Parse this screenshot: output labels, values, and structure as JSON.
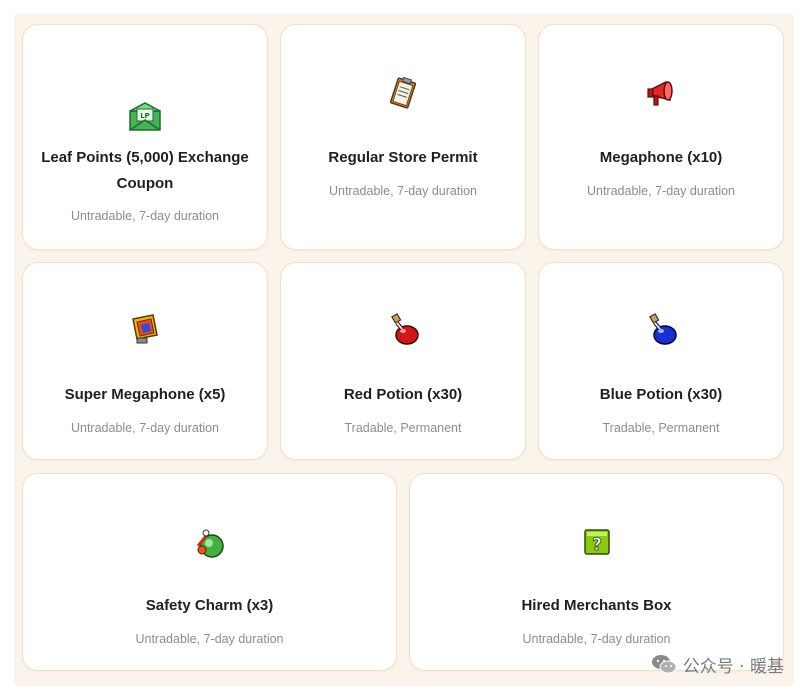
{
  "items": [
    {
      "title": "Leaf Points (5,000) Exchange Coupon",
      "subtitle": "Untradable, 7-day duration",
      "icon": "leaf-points-coupon-icon"
    },
    {
      "title": "Regular Store Permit",
      "subtitle": "Untradable, 7-day duration",
      "icon": "store-permit-icon"
    },
    {
      "title": "Megaphone (x10)",
      "subtitle": "Untradable, 7-day duration",
      "icon": "megaphone-icon"
    },
    {
      "title": "Super Megaphone (x5)",
      "subtitle": "Untradable, 7-day duration",
      "icon": "super-megaphone-icon"
    },
    {
      "title": "Red Potion (x30)",
      "subtitle": "Tradable, Permanent",
      "icon": "red-potion-icon"
    },
    {
      "title": "Blue Potion (x30)",
      "subtitle": "Tradable, Permanent",
      "icon": "blue-potion-icon"
    },
    {
      "title": "Safety Charm (x3)",
      "subtitle": "Untradable, 7-day duration",
      "icon": "safety-charm-icon"
    },
    {
      "title": "Hired Merchants Box",
      "subtitle": "Untradable, 7-day duration",
      "icon": "hired-merchants-box-icon"
    }
  ],
  "watermark": {
    "text": "公众号 · 暖基",
    "icon": "wechat-icon"
  },
  "colors": {
    "card_border": "#f0dfcc",
    "panel_bg": "#fbf4ea",
    "title": "#1f1f1f",
    "subtitle": "#8d8d8d"
  }
}
